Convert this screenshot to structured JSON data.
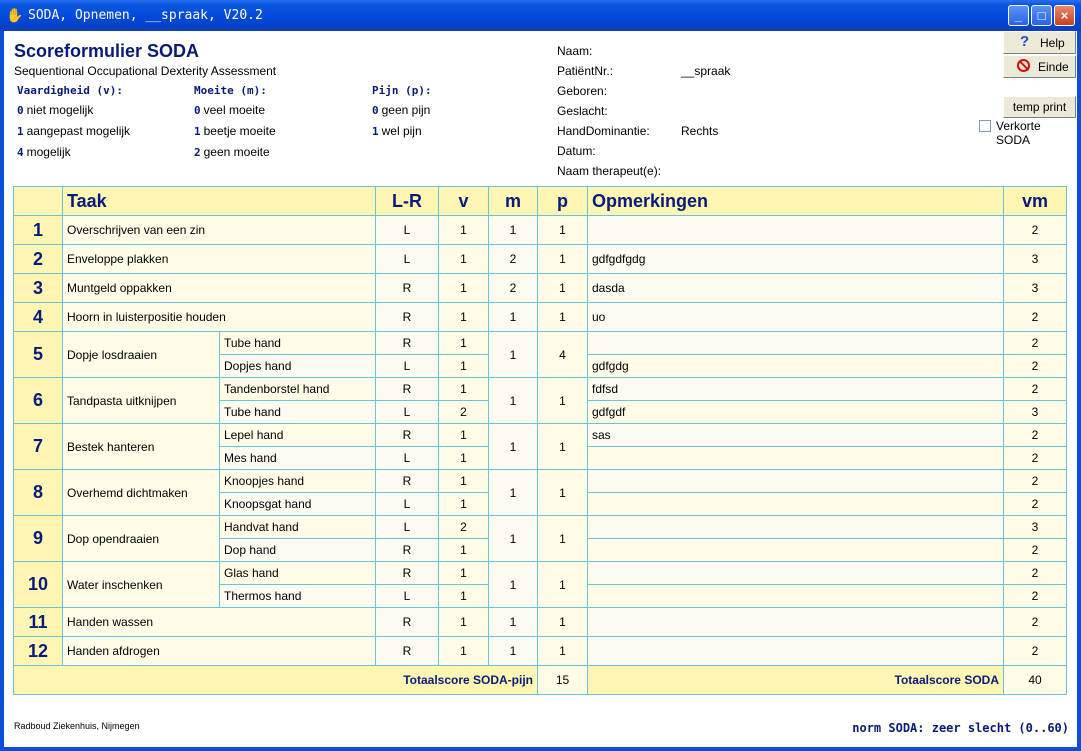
{
  "window": {
    "title": "SODA, Opnemen, __spraak, V20.2"
  },
  "header": {
    "title": "Scoreformulier SODA",
    "subtitle": "Sequentional Occupational Dexterity Assessment"
  },
  "legend": {
    "v": {
      "heading": "Vaardigheid (v):",
      "items": [
        {
          "code": "0",
          "label": "niet mogelijk"
        },
        {
          "code": "1",
          "label": "aangepast mogelijk"
        },
        {
          "code": "4",
          "label": "mogelijk"
        }
      ]
    },
    "m": {
      "heading": "Moeite (m):",
      "items": [
        {
          "code": "0",
          "label": "veel moeite"
        },
        {
          "code": "1",
          "label": "beetje moeite"
        },
        {
          "code": "2",
          "label": "geen moeite"
        }
      ]
    },
    "p": {
      "heading": "Pijn (p):",
      "items": [
        {
          "code": "0",
          "label": "geen pijn"
        },
        {
          "code": "1",
          "label": "wel pijn"
        }
      ]
    }
  },
  "patient": {
    "naam": {
      "label": "Naam:",
      "value": ""
    },
    "nr": {
      "label": "PatiëntNr.:",
      "value": "__spraak"
    },
    "geboren": {
      "label": "Geboren:",
      "value": ""
    },
    "geslacht": {
      "label": "Geslacht:",
      "value": ""
    },
    "hand": {
      "label": "HandDominantie:",
      "value": "Rechts"
    },
    "datum": {
      "label": "Datum:",
      "value": ""
    },
    "therapeut": {
      "label": "Naam therapeut(e):",
      "value": ""
    }
  },
  "buttons": {
    "help": "Help",
    "einde": "Einde",
    "temp_print": "temp print",
    "verkorte": "Verkorte SODA"
  },
  "columns": {
    "taak": "Taak",
    "lr": "L-R",
    "v": "v",
    "m": "m",
    "p": "p",
    "opm": "Opmerkingen",
    "vm": "vm"
  },
  "tasks": [
    {
      "nr": "1",
      "name": "Overschrijven van een zin",
      "lr": "L",
      "v": "1",
      "m": "1",
      "p": "1",
      "opm": "",
      "vm": "2"
    },
    {
      "nr": "2",
      "name": "Enveloppe plakken",
      "lr": "L",
      "v": "1",
      "m": "2",
      "p": "1",
      "opm": "gdfgdfgdg",
      "vm": "3"
    },
    {
      "nr": "3",
      "name": "Muntgeld oppakken",
      "lr": "R",
      "v": "1",
      "m": "2",
      "p": "1",
      "opm": "dasda",
      "vm": "3"
    },
    {
      "nr": "4",
      "name": "Hoorn in luisterpositie houden",
      "lr": "R",
      "v": "1",
      "m": "1",
      "p": "1",
      "opm": "uo",
      "vm": "2"
    },
    {
      "nr": "5",
      "name": "Dopje losdraaien",
      "m": "1",
      "p": "4",
      "subs": [
        {
          "name": "Tube hand",
          "lr": "R",
          "v": "1",
          "opm": "",
          "vm": "2"
        },
        {
          "name": "Dopjes hand",
          "lr": "L",
          "v": "1",
          "opm": "gdfgdg",
          "vm": "2"
        }
      ]
    },
    {
      "nr": "6",
      "name": "Tandpasta uitknijpen",
      "m": "1",
      "p": "1",
      "subs": [
        {
          "name": "Tandenborstel hand",
          "lr": "R",
          "v": "1",
          "opm": "fdfsd",
          "vm": "2"
        },
        {
          "name": "Tube hand",
          "lr": "L",
          "v": "2",
          "opm": "gdfgdf",
          "vm": "3"
        }
      ]
    },
    {
      "nr": "7",
      "name": "Bestek hanteren",
      "m": "1",
      "p": "1",
      "subs": [
        {
          "name": "Lepel hand",
          "lr": "R",
          "v": "1",
          "opm": "sas",
          "vm": "2"
        },
        {
          "name": "Mes hand",
          "lr": "L",
          "v": "1",
          "opm": "",
          "vm": "2"
        }
      ]
    },
    {
      "nr": "8",
      "name": "Overhemd dichtmaken",
      "m": "1",
      "p": "1",
      "subs": [
        {
          "name": "Knoopjes hand",
          "lr": "R",
          "v": "1",
          "opm": "",
          "vm": "2"
        },
        {
          "name": "Knoopsgat hand",
          "lr": "L",
          "v": "1",
          "opm": "",
          "vm": "2"
        }
      ]
    },
    {
      "nr": "9",
      "name": "Dop opendraaien",
      "m": "1",
      "p": "1",
      "subs": [
        {
          "name": "Handvat hand",
          "lr": "L",
          "v": "2",
          "opm": "",
          "vm": "3"
        },
        {
          "name": "Dop hand",
          "lr": "R",
          "v": "1",
          "opm": "",
          "vm": "2"
        }
      ]
    },
    {
      "nr": "10",
      "name": "Water inschenken",
      "m": "1",
      "p": "1",
      "subs": [
        {
          "name": "Glas hand",
          "lr": "R",
          "v": "1",
          "opm": "",
          "vm": "2"
        },
        {
          "name": "Thermos hand",
          "lr": "L",
          "v": "1",
          "opm": "",
          "vm": "2"
        }
      ]
    },
    {
      "nr": "11",
      "name": "Handen wassen",
      "lr": "R",
      "v": "1",
      "m": "1",
      "p": "1",
      "opm": "",
      "vm": "2"
    },
    {
      "nr": "12",
      "name": "Handen afdrogen",
      "lr": "R",
      "v": "1",
      "m": "1",
      "p": "1",
      "opm": "",
      "vm": "2"
    }
  ],
  "totals": {
    "pijn_label": "Totaalscore SODA-pijn",
    "pijn_value": "15",
    "soda_label": "Totaalscore SODA",
    "soda_value": "40"
  },
  "footer": {
    "left": "Radboud Ziekenhuis, Nijmegen",
    "norm": "norm SODA: zeer slecht (0..60)"
  }
}
